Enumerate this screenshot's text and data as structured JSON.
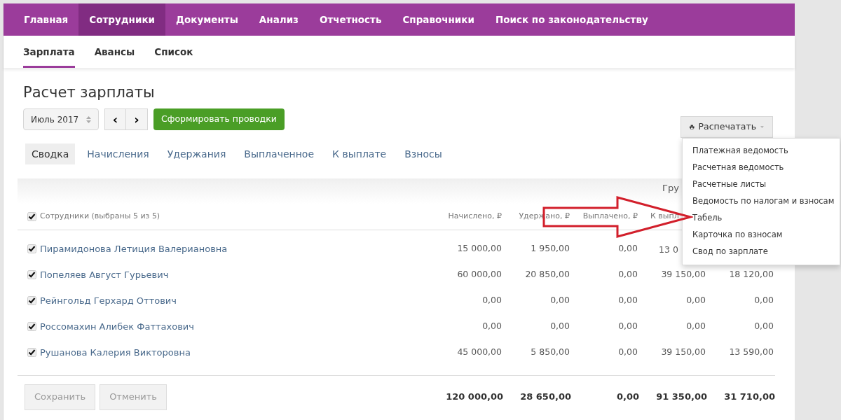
{
  "top_nav": [
    {
      "label": "Главная",
      "selected": false
    },
    {
      "label": "Сотрудники",
      "selected": true
    },
    {
      "label": "Документы",
      "selected": false
    },
    {
      "label": "Анализ",
      "selected": false
    },
    {
      "label": "Отчетность",
      "selected": false
    },
    {
      "label": "Справочники",
      "selected": false
    },
    {
      "label": "Поиск по законодательству",
      "selected": false
    }
  ],
  "sub_nav": [
    {
      "label": "Зарплата",
      "selected": true
    },
    {
      "label": "Авансы",
      "selected": false
    },
    {
      "label": "Список",
      "selected": false
    }
  ],
  "title": "Расчет зарплаты",
  "period": "Июль 2017",
  "prev_button": "‹",
  "next_button": "›",
  "generate_button": "Сформировать проводки",
  "print_button": "Распечатать",
  "print_menu": [
    "Платежная ведомость",
    "Расчетная ведомость",
    "Расчетные листы",
    "Ведомость по налогам и взносам",
    "Табель",
    "Карточка по взносам",
    "Свод по зарплате"
  ],
  "tabs": [
    {
      "label": "Сводка",
      "selected": true
    },
    {
      "label": "Начисления",
      "selected": false
    },
    {
      "label": "Удержания",
      "selected": false
    },
    {
      "label": "Выплаченное",
      "selected": false
    },
    {
      "label": "К выплате",
      "selected": false
    },
    {
      "label": "Взносы",
      "selected": false
    }
  ],
  "group_label": "Гру",
  "table": {
    "select_all": {
      "label": "Сотрудники (выбраны 5 из 5)",
      "checked": true
    },
    "columns": [
      "Начислено, ₽",
      "Удержано, ₽",
      "Выплачено, ₽",
      "К выпл"
    ],
    "rows": [
      {
        "name": "Пирамидонова Летиция Валериановна",
        "checked": true,
        "values": [
          "15 000,00",
          "1 950,00",
          "0,00",
          "13 0"
        ]
      },
      {
        "name": "Попеляев Август Гурьевич",
        "checked": true,
        "values": [
          "60 000,00",
          "20 850,00",
          "0,00",
          "39 150,00",
          "18 120,00"
        ]
      },
      {
        "name": "Рейнгольд Герхард Оттович",
        "checked": true,
        "values": [
          "0,00",
          "0,00",
          "0,00",
          "0,00",
          "0,00"
        ]
      },
      {
        "name": "Россомахин Алибек Фаттахович",
        "checked": true,
        "values": [
          "0,00",
          "0,00",
          "0,00",
          "0,00",
          "0,00"
        ]
      },
      {
        "name": "Рушанова Калерия Викторовна",
        "checked": true,
        "values": [
          "45 000,00",
          "5 850,00",
          "0,00",
          "39 150,00",
          "13 590,00"
        ]
      }
    ],
    "totals": [
      "120 000,00",
      "28 650,00",
      "0,00",
      "91 350,00",
      "31 710,00"
    ]
  },
  "buttons": [
    {
      "label": "Сохранить",
      "disabled": true
    },
    {
      "label": "Отменить",
      "disabled": true
    }
  ]
}
